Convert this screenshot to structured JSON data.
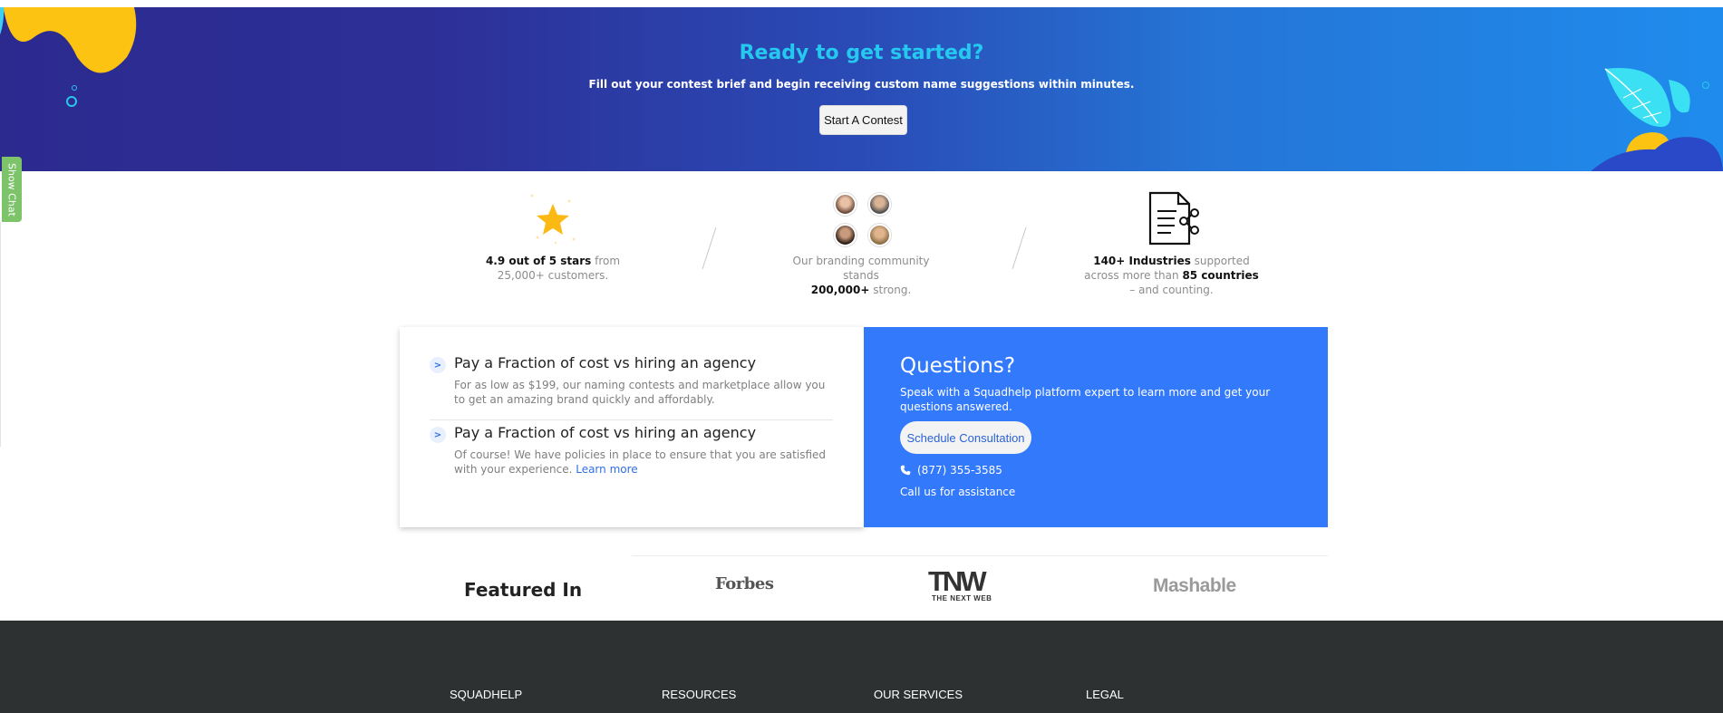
{
  "hero": {
    "title": "Ready to get started?",
    "subtitle": "Fill out your contest brief and begin receiving custom name suggestions within minutes.",
    "cta_label": "Start A Contest"
  },
  "chat": {
    "label": "Show Chat"
  },
  "stats": [
    {
      "bold": "4.9 out of 5 stars",
      "rest": " from 25,000+ customers.",
      "icon": "star-icon"
    },
    {
      "pre": "Our branding community stands ",
      "bold": "200,000+",
      "rest": " strong.",
      "icon": "avatar-group"
    },
    {
      "bold": "140+ Industries",
      "mid": " supported across more than ",
      "bold2": "85 countries",
      "rest": " – and counting.",
      "icon": "document-share-icon"
    }
  ],
  "faqs": [
    {
      "title": "Pay a Fraction of cost vs hiring an agency",
      "text": "For as low as $199, our naming contests and marketplace allow you to get an amazing brand quickly and affordably."
    },
    {
      "title": "Pay a Fraction of cost vs hiring an agency",
      "text": "Of course! We have policies in place to ensure that you are satisfied with your experience. ",
      "link": "Learn more"
    }
  ],
  "questions": {
    "title": "Questions?",
    "text": "Speak with a Squadhelp platform expert to learn more and get your questions answered.",
    "button_label": "Schedule Consultation",
    "phone": "(877) 355-3585",
    "assist": "Call us for assistance"
  },
  "featured": {
    "title": "Featured In",
    "logos": [
      "Forbes",
      "TNW",
      "THE NEXT WEB",
      "Mashable"
    ]
  },
  "footer": {
    "columns": [
      "SQUADHELP",
      "RESOURCES",
      "OUR SERVICES",
      "LEGAL"
    ]
  },
  "colors": {
    "hero_title": "#25c9f0",
    "questions_bg": "#3379fb",
    "footer_bg": "#2d3131",
    "chat_tab": "#7cc36a"
  }
}
